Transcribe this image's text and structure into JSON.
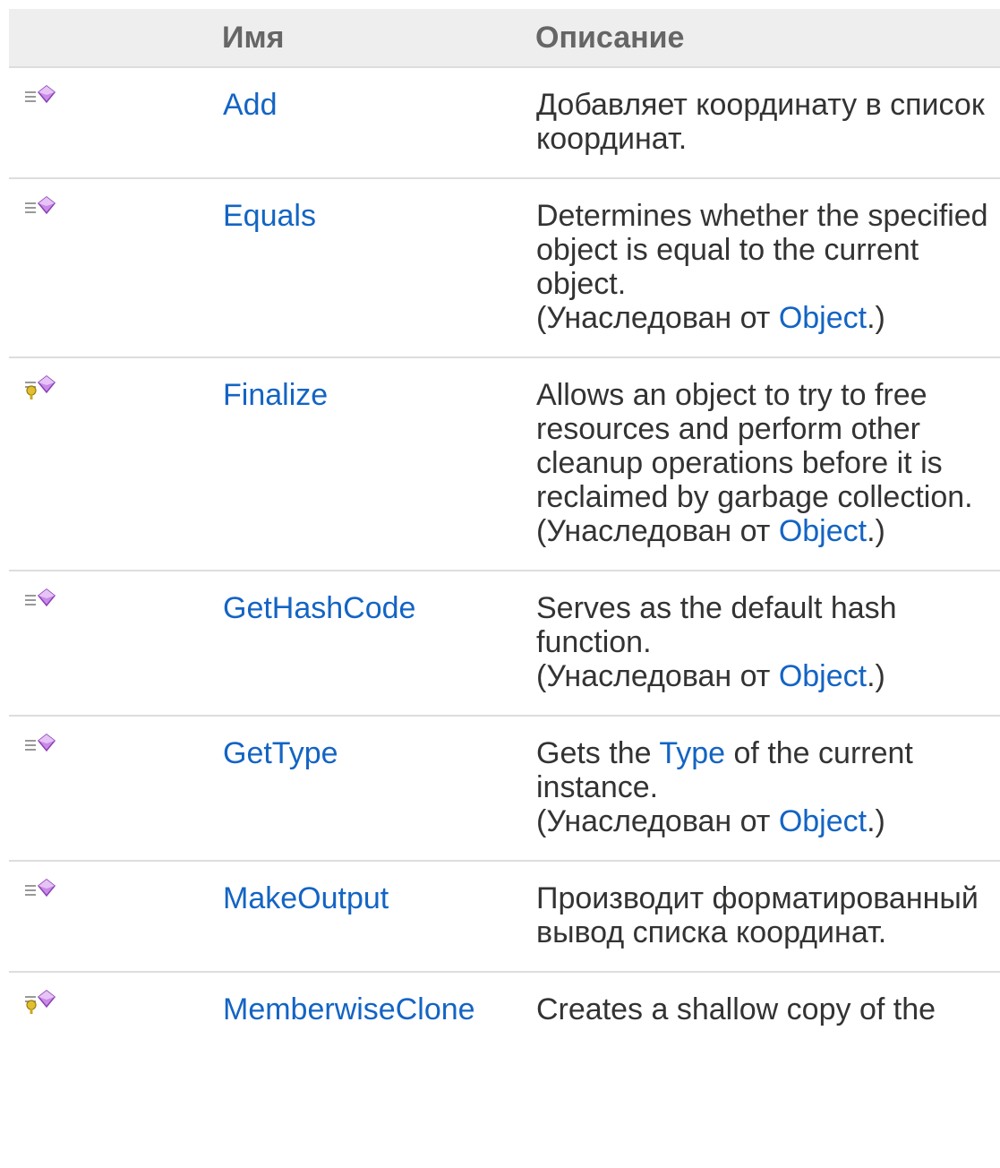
{
  "header": {
    "name_label": "Имя",
    "description_label": "Описание"
  },
  "rows": [
    {
      "icon": "public-method-icon",
      "name": "Add",
      "desc": "Добавляет координату в список координат."
    },
    {
      "icon": "public-method-icon",
      "name": "Equals",
      "desc": "Determines whether the specified object is equal to the current object.",
      "inherited_prefix": "(Унаследован от ",
      "inherited_link": "Object",
      "inherited_suffix": ".)"
    },
    {
      "icon": "protected-method-icon",
      "name": "Finalize",
      "desc": "Allows an object to try to free resources and perform other cleanup operations before it is reclaimed by garbage collection.",
      "inherited_prefix": "(Унаследован от ",
      "inherited_link": "Object",
      "inherited_suffix": ".)"
    },
    {
      "icon": "public-method-icon",
      "name": "GetHashCode",
      "desc": "Serves as the default hash function.",
      "inherited_prefix": "(Унаследован от ",
      "inherited_link": "Object",
      "inherited_suffix": ".)"
    },
    {
      "icon": "public-method-icon",
      "name": "GetType",
      "desc_before": "Gets the ",
      "desc_link": "Type",
      "desc_after": " of the current instance.",
      "inherited_prefix": "(Унаследован от ",
      "inherited_link": "Object",
      "inherited_suffix": ".)"
    },
    {
      "icon": "public-method-icon",
      "name": "MakeOutput",
      "desc": "Производит форматированный вывод списка координат."
    },
    {
      "icon": "protected-method-icon",
      "name": "MemberwiseClone",
      "desc": "Creates a shallow copy of the"
    }
  ],
  "colors": {
    "link": "#1364c4",
    "header_bg": "#eeeeee",
    "header_text": "#666666",
    "border": "#dddddd",
    "method_icon_purple": "#b066d6",
    "protected_key_yellow": "#e0c030"
  }
}
